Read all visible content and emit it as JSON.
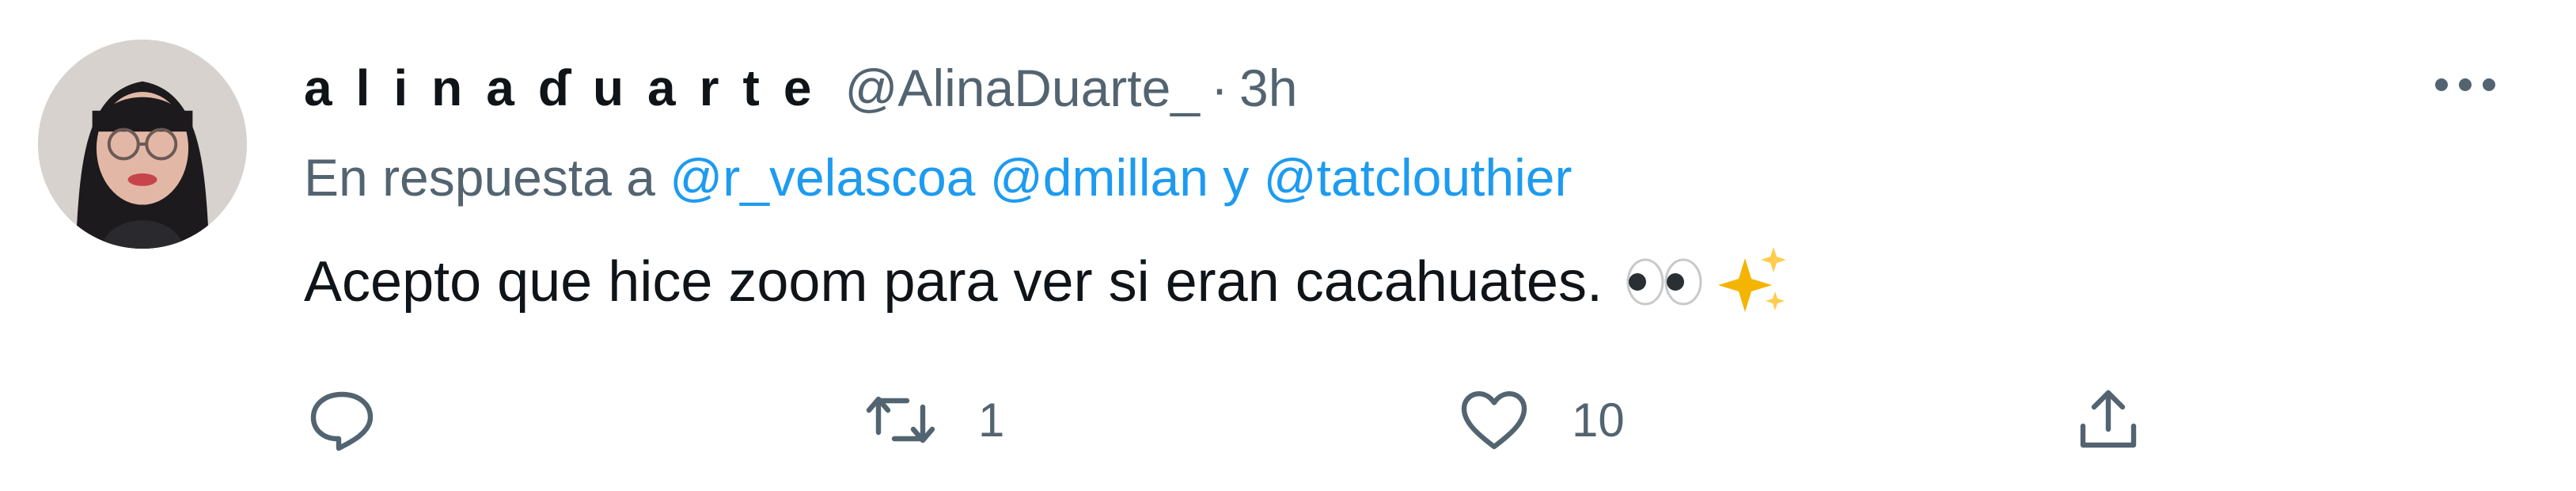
{
  "tweet": {
    "author": {
      "display_name": "alinaɗuarte",
      "handle": "@AlinaDuarte_",
      "avatar_icon": "profile-photo"
    },
    "separator": "·",
    "time": "3h",
    "reply_context": {
      "prefix": "En respuesta a",
      "mention_1": "@r_velascoa",
      "mention_2": "@dmillan",
      "conjunction": "y",
      "mention_3": "@tatclouthier"
    },
    "text": "Acepto que hice zoom para ver si eran cacahuates.",
    "emojis": [
      "eyes-emoji",
      "sparkles-emoji"
    ],
    "actions": {
      "reply": {
        "icon": "reply-icon",
        "count": ""
      },
      "retweet": {
        "icon": "retweet-icon",
        "count": "1"
      },
      "like": {
        "icon": "heart-icon",
        "count": "10"
      },
      "share": {
        "icon": "share-icon",
        "count": ""
      }
    },
    "more_icon": "more-dots-icon"
  },
  "colors": {
    "text_primary": "#0f1419",
    "text_secondary": "#536471",
    "link": "#1d9bf0",
    "sparkle": "#f4b400"
  }
}
